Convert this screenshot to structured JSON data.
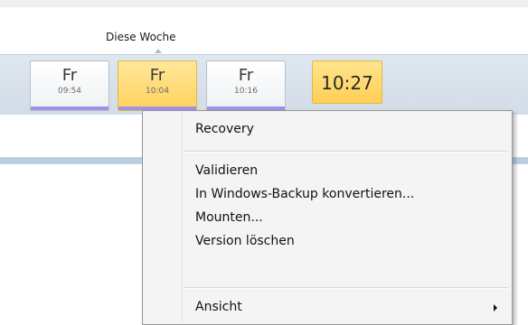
{
  "timeline": {
    "week_label": "Diese Woche",
    "versions": [
      {
        "day": "Fr",
        "time": "09:54"
      },
      {
        "day": "Fr",
        "time": "10:04"
      },
      {
        "day": "Fr",
        "time": "10:16"
      }
    ],
    "current_time": "10:27"
  },
  "menu": {
    "items": [
      "Recovery",
      "Validieren",
      "In Windows-Backup konvertieren...",
      "Mounten...",
      "Version löschen",
      "Ansicht"
    ]
  },
  "colors": {
    "selected_tile": "#ffd25c",
    "stripe": "#9f93e6",
    "timeline_bg": "#d2dce7"
  }
}
